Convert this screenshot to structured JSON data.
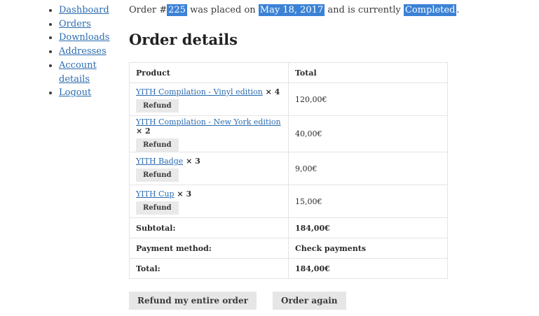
{
  "nav": {
    "items": [
      {
        "label": "Dashboard"
      },
      {
        "label": "Orders"
      },
      {
        "label": "Downloads"
      },
      {
        "label": "Addresses"
      },
      {
        "label": "Account"
      },
      {
        "label": "details"
      },
      {
        "label": "Logout"
      }
    ]
  },
  "notice": {
    "prefix": "Order #",
    "order_number": "225",
    "mid1": " was placed on ",
    "date": "May 18, 2017",
    "mid2": " and is currently ",
    "status": "Completed",
    "suffix": "."
  },
  "details": {
    "title": "Order details",
    "headers": {
      "product": "Product",
      "total": "Total"
    },
    "rows": [
      {
        "product": "YITH Compilation - Vinyl edition",
        "qty": " × 4",
        "refund": "Refund",
        "total": "120,00€"
      },
      {
        "product": "YITH Compilation - New York edition",
        "qty": " × 2",
        "refund": "Refund",
        "total": "40,00€"
      },
      {
        "product": "YITH Badge",
        "qty": " × 3",
        "refund": "Refund",
        "total": "9,00€"
      },
      {
        "product": "YITH Cup",
        "qty": " × 3",
        "refund": "Refund",
        "total": "15,00€"
      }
    ],
    "footer": [
      {
        "label": "Subtotal:",
        "value": "184,00€"
      },
      {
        "label": "Payment method:",
        "value": "Check payments"
      },
      {
        "label": "Total:",
        "value": "184,00€"
      }
    ]
  },
  "actions": {
    "refund_all": "Refund my entire order",
    "order_again": "Order again"
  },
  "colors": {
    "link": "#2b6cb0",
    "highlight": "#3b82d6",
    "button_bg": "#e6e6e6"
  }
}
